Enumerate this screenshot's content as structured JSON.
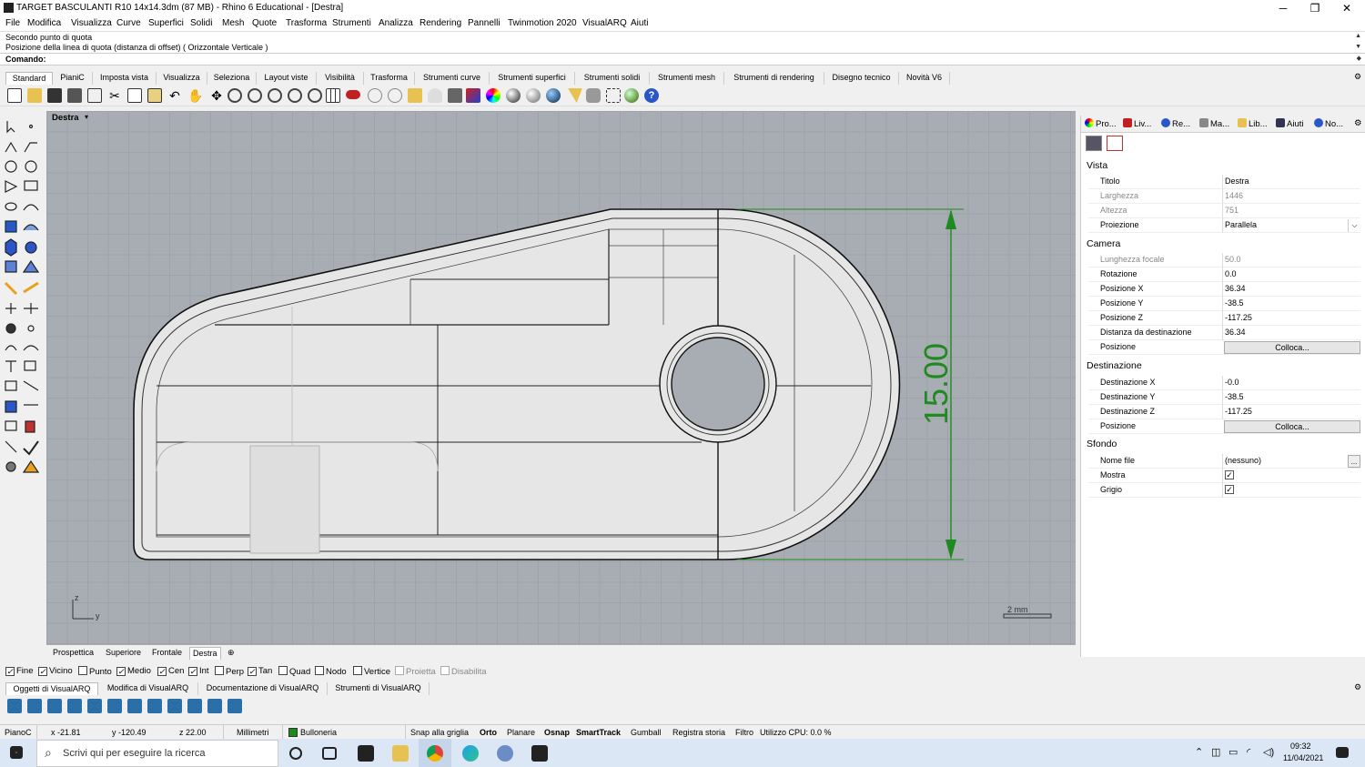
{
  "window": {
    "title": "TARGET BASCULANTI R10 14x14.3dm (87 MB) - Rhino 6 Educational - [Destra]",
    "minimize": "─",
    "maximize": "❐",
    "close": "✕"
  },
  "menu": [
    "File",
    "Modifica",
    "Visualizza",
    "Curve",
    "Superfici",
    "Solidi",
    "Mesh",
    "Quote",
    "Trasforma",
    "Strumenti",
    "Analizza",
    "Rendering",
    "Pannelli",
    "Twinmotion 2020",
    "VisualARQ",
    "Aiuti"
  ],
  "command": {
    "history": [
      "Secondo punto di quota",
      "Posizione della linea di quota (distanza di offset) ( Orizzontale  Verticale )"
    ],
    "prompt": "Comando:"
  },
  "toolbar_tabs": [
    "Standard",
    "PianiC",
    "Imposta vista",
    "Visualizza",
    "Seleziona",
    "Layout viste",
    "Visibilità",
    "Trasforma",
    "Strumenti curve",
    "Strumenti superfici",
    "Strumenti solidi",
    "Strumenti mesh",
    "Strumenti di rendering",
    "Disegno tecnico",
    "Novità V6"
  ],
  "viewport": {
    "name": "Destra",
    "dimension_value": "15.00",
    "scale_label": "2 mm",
    "axis_z": "z",
    "axis_y": "y",
    "colors": {
      "background": "#a8adb3",
      "dimension": "#1f8a1f"
    }
  },
  "view_tabs": [
    "Prospettica",
    "Superiore",
    "Frontale",
    "Destra"
  ],
  "panel": {
    "tabs": [
      "Pro...",
      "Liv...",
      "Re...",
      "Ma...",
      "Lib...",
      "Aiuti",
      "No..."
    ],
    "sections": {
      "vista": "Vista",
      "camera": "Camera",
      "destinazione": "Destinazione",
      "sfondo": "Sfondo"
    },
    "vista": [
      {
        "k": "Titolo",
        "v": "Destra"
      },
      {
        "k": "Larghezza",
        "v": "1446"
      },
      {
        "k": "Altezza",
        "v": "751"
      },
      {
        "k": "Proiezione",
        "v": "Parallela"
      }
    ],
    "camera": [
      {
        "k": "Lunghezza focale",
        "v": "50.0"
      },
      {
        "k": "Rotazione",
        "v": "0.0"
      },
      {
        "k": "Posizione X",
        "v": "36.34"
      },
      {
        "k": "Posizione Y",
        "v": "-38.5"
      },
      {
        "k": "Posizione Z",
        "v": "-117.25"
      },
      {
        "k": "Distanza da destinazione",
        "v": "36.34"
      },
      {
        "k": "Posizione",
        "v": "Colloca..."
      }
    ],
    "destinazione": [
      {
        "k": "Destinazione X",
        "v": "-0.0"
      },
      {
        "k": "Destinazione Y",
        "v": "-38.5"
      },
      {
        "k": "Destinazione Z",
        "v": "-117.25"
      },
      {
        "k": "Posizione",
        "v": "Colloca..."
      }
    ],
    "sfondo": [
      {
        "k": "Nome file",
        "v": "(nessuno)"
      },
      {
        "k": "Mostra",
        "v": "✓"
      },
      {
        "k": "Grigio",
        "v": "✓"
      }
    ],
    "browse": "..."
  },
  "osnap": [
    {
      "label": "Fine",
      "checked": true
    },
    {
      "label": "Vicino",
      "checked": true
    },
    {
      "label": "Punto",
      "checked": false
    },
    {
      "label": "Medio",
      "checked": true
    },
    {
      "label": "Cen",
      "checked": true
    },
    {
      "label": "Int",
      "checked": true
    },
    {
      "label": "Perp",
      "checked": false
    },
    {
      "label": "Tan",
      "checked": true
    },
    {
      "label": "Quad",
      "checked": false
    },
    {
      "label": "Nodo",
      "checked": false
    },
    {
      "label": "Vertice",
      "checked": false
    },
    {
      "label": "Proietta",
      "checked": false
    },
    {
      "label": "Disabilita",
      "checked": false
    }
  ],
  "visualarq_tabs": [
    "Oggetti di VisualARQ",
    "Modifica di VisualARQ",
    "Documentazione di VisualARQ",
    "Strumenti di VisualARQ"
  ],
  "status": {
    "plane": "PianoC",
    "x": "x -21.81",
    "y": "y -120.49",
    "z": "z 22.00",
    "units": "Millimetri",
    "layer": "Bulloneria",
    "layer_color": "#1a8c1a",
    "snap": "Snap alla griglia",
    "orto": "Orto",
    "planare": "Planare",
    "osnap": "Osnap",
    "smarttrack": "SmartTrack",
    "gumball": "Gumball",
    "history": "Registra storia",
    "filter": "Filtro",
    "cpu": "Utilizzo CPU: 0.0 %"
  },
  "taskbar": {
    "search_placeholder": "Scrivi qui per eseguire la ricerca",
    "time": "09:32",
    "date": "11/04/2021"
  }
}
